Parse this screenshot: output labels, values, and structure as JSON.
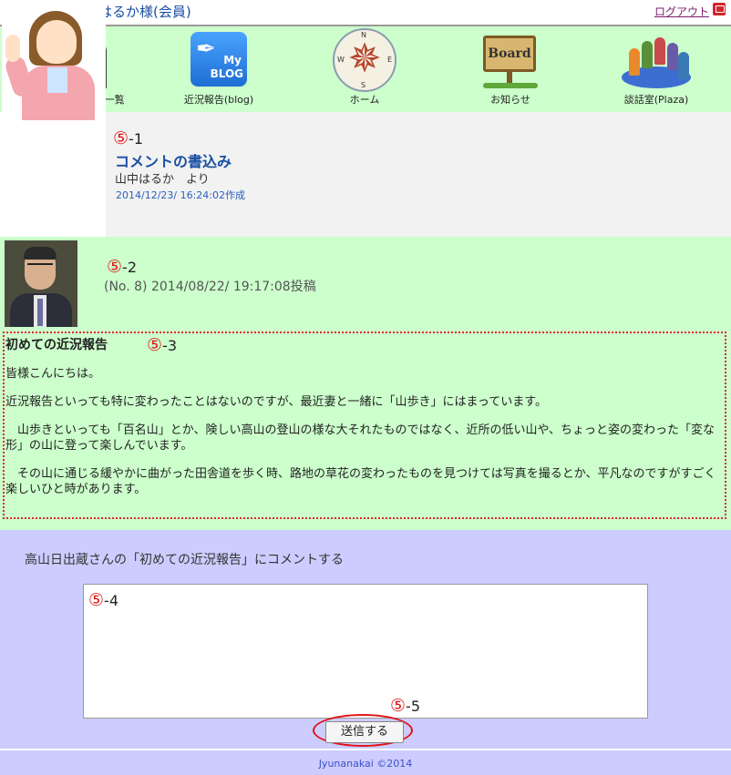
{
  "header": {
    "welcome": "ようこそ！山中はるか様(会員)",
    "logout": "ログアウト"
  },
  "nav": [
    {
      "label": "メッセージ＆ 会員一覧"
    },
    {
      "label": "近況報告(blog)",
      "icon_text_1": "My",
      "icon_text_2": "BLOG"
    },
    {
      "label": "ホーム",
      "compass": {
        "n": "N",
        "s": "S",
        "w": "W",
        "e": "E"
      }
    },
    {
      "label": "お知らせ",
      "icon_text": "Board"
    },
    {
      "label": "談話室(Plaza)"
    }
  ],
  "markers": {
    "m1": {
      "symbol": "⑤",
      "num": "-1"
    },
    "m2": {
      "symbol": "⑤",
      "num": "-2"
    },
    "m3": {
      "symbol": "⑤",
      "num": "-3"
    },
    "m4": {
      "symbol": "⑤",
      "num": "-4"
    },
    "m5": {
      "symbol": "⑤",
      "num": "-5"
    }
  },
  "comment_header": {
    "title": "コメントの書込み",
    "from": "山中はるか　より",
    "created": "2014/12/23/ 16:24:02作成"
  },
  "post": {
    "meta": "(No. 8) 2014/08/22/ 19:17:08投稿",
    "title": "初めての近況報告",
    "paragraphs": [
      "皆様こんにちは。",
      "近況報告といっても特に変わったことはないのですが、最近妻と一緒に「山歩き」にはまっています。",
      "　山歩きといっても「百名山」とか、険しい高山の登山の様な大それたものではなく、近所の低い山や、ちょっと姿の変わった「変な形」の山に登って楽しんでいます。",
      "　その山に通じる緩やかに曲がった田舎道を歩く時、路地の草花の変わったものを見つけては写真を撮るとか、平凡なのですがすごく楽しいひと時があります。"
    ]
  },
  "comment_form": {
    "prompt": "高山日出蔵さんの「初めての近況報告」にコメントする",
    "textarea_value": "",
    "submit_label": "送信する"
  },
  "footer": {
    "text": "Jyunanakai ©2014"
  },
  "colors": {
    "green_bg": "#ccffcc",
    "purple_bg": "#ccccff",
    "link_blue": "#1a4fa3",
    "marker_red": "#e01515"
  }
}
